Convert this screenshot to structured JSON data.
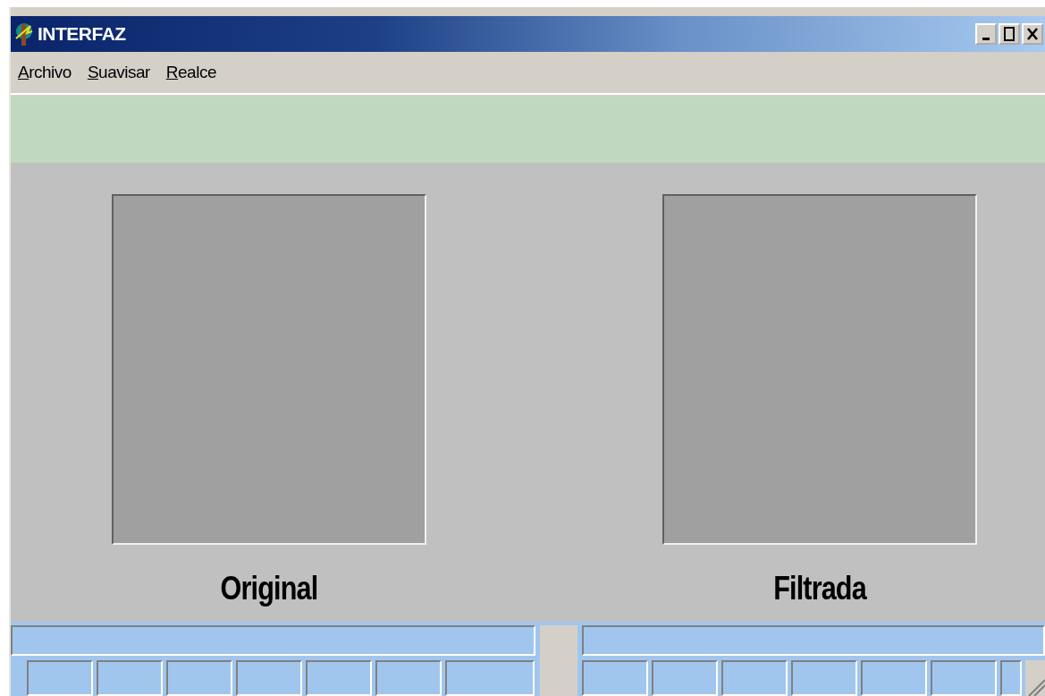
{
  "window": {
    "title": "INTERFAZ"
  },
  "menu": [
    {
      "label": "Archivo"
    },
    {
      "label": "Suavisar"
    },
    {
      "label": "Realce"
    }
  ],
  "images": [
    {
      "label": "Original"
    },
    {
      "label": "Filtrada"
    }
  ]
}
